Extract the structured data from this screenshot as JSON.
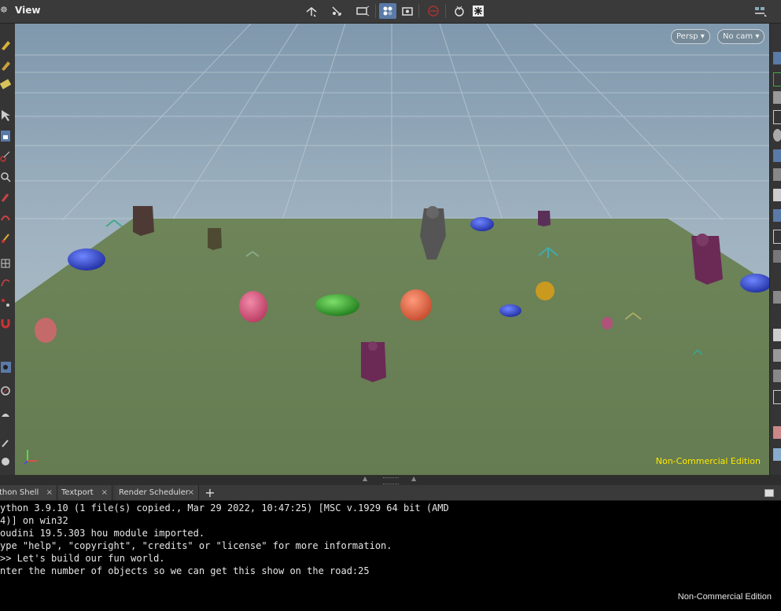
{
  "header": {
    "title": "View",
    "tools": [
      "select-transform-icon",
      "pose-icon",
      "handle-icon",
      "display-options-icon",
      "camera-icon",
      "stop-icon",
      "render-settings-icon",
      "snapshot-icon",
      "layout-icon"
    ]
  },
  "viewport": {
    "persp_label": "Persp",
    "camera_label": "No cam",
    "watermark": "Non-Commercial Edition",
    "ground_color": "#697f54",
    "sky_color": "#8fa6b8"
  },
  "tabs": [
    {
      "label": "thon Shell",
      "close": "×"
    },
    {
      "label": "Textport",
      "close": "×"
    },
    {
      "label": "Render Scheduler",
      "close": "×"
    }
  ],
  "add_tab": "+",
  "shell": {
    "lines": [
      "ython 3.9.10 (1 file(s) copied., Mar 29 2022, 10:47:25) [MSC v.1929 64 bit (AMD",
      "4)] on win32",
      "oudini 19.5.303 hou module imported.",
      "ype \"help\", \"copyright\", \"credits\" or \"license\" for more information.",
      ">> Let's build our fun world.",
      "nter the number of objects so we can get this show on the road:25"
    ],
    "watermark": "Non-Commercial Edition"
  }
}
